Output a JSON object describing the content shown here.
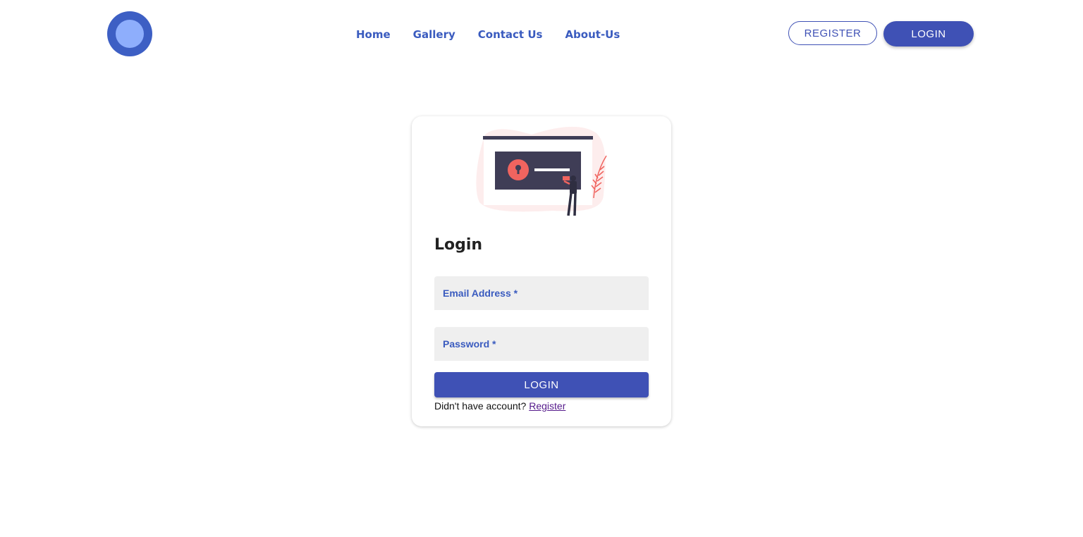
{
  "nav": {
    "links": [
      "Home",
      "Gallery",
      "Contact Us",
      "About-Us"
    ],
    "register_label": "REGISTER",
    "login_label": "LOGIN"
  },
  "login_card": {
    "title": "Login",
    "email_label": "Email Address *",
    "password_label": "Password *",
    "submit_label": "LOGIN",
    "footer_prompt": "Didn't have account?",
    "footer_link": "Register"
  },
  "colors": {
    "primary": "#3f51b5",
    "nav_link": "#3a5bbf",
    "logo_outer": "#3d5fc4",
    "logo_inner": "#8eaefc",
    "accent": "#f0645f"
  }
}
